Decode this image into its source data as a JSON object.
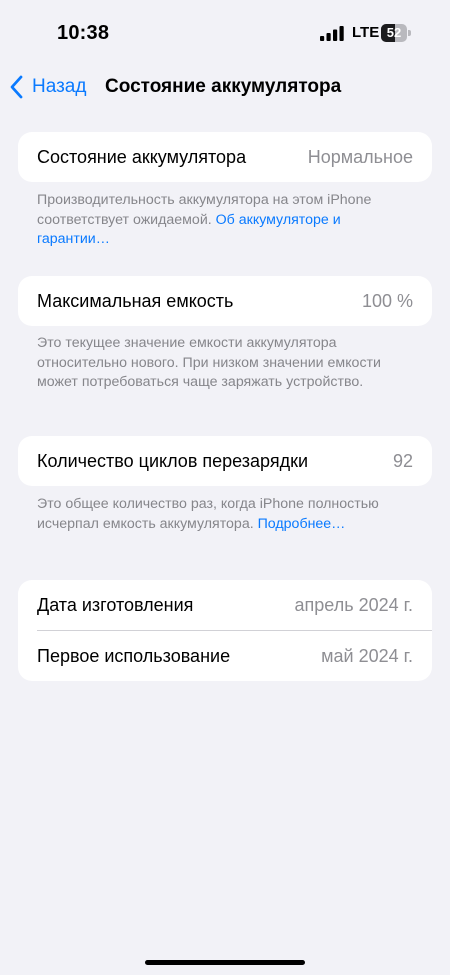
{
  "status_bar": {
    "time": "10:38",
    "network": "LTE",
    "battery_level": "52",
    "battery_fraction": 0.52
  },
  "nav": {
    "back_label": "Назад",
    "title": "Состояние аккумулятора"
  },
  "battery_health": {
    "label": "Состояние аккумулятора",
    "value": "Нормальное",
    "footnote_text": "Производительность аккумулятора на этом iPhone соответствует ожидаемой. ",
    "footnote_link": "Об аккумуляторе и гарантии…"
  },
  "max_capacity": {
    "label": "Максимальная емкость",
    "value": "100 %",
    "footnote_text": "Это текущее значение емкости аккумулятора относительно нового. При низком значении емкости может потребоваться чаще заряжать устройство."
  },
  "cycle_count": {
    "label": "Количество циклов перезарядки",
    "value": "92",
    "footnote_text": "Это общее количество раз, когда iPhone полностью исчерпал емкость аккумулятора. ",
    "footnote_link": "Подробнее…"
  },
  "dates": {
    "manufacture_label": "Дата изготовления",
    "manufacture_value": "апрель 2024 г.",
    "first_use_label": "Первое использование",
    "first_use_value": "май 2024 г."
  },
  "colors": {
    "background": "#f2f2f7",
    "accent": "#0a7aff",
    "secondary_text": "#8e8e93"
  }
}
